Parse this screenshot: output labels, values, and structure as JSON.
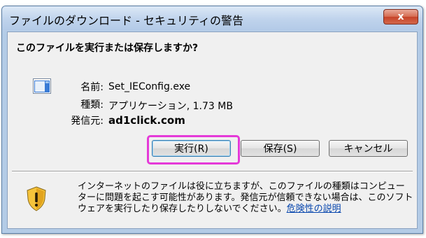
{
  "window": {
    "title": "ファイルのダウンロード - セキュリティの警告",
    "close_label": "x"
  },
  "dialog": {
    "question": "このファイルを実行または保存しますか?",
    "file_icon": "exe-file-icon",
    "fields": {
      "name_label": "名前:",
      "name_value": "Set_IEConfig.exe",
      "type_label": "種類:",
      "type_value": "アプリケーション, 1.73 MB",
      "publisher_label": "発信元:",
      "publisher_value": "ad1click.com"
    },
    "buttons": {
      "run": "実行(R)",
      "save": "保存(S)",
      "cancel": "キャンセル"
    },
    "highlight_color": "#e53ad8",
    "warning": {
      "icon": "shield-warning-icon",
      "text": "インターネットのファイルは役に立ちますが、このファイルの種類はコンピューターに問題を起こす可能性があります。発信元が信頼できない場合は、このソフトウェアを実行したり保存したりしないでください。",
      "link": "危険性の説明"
    }
  }
}
